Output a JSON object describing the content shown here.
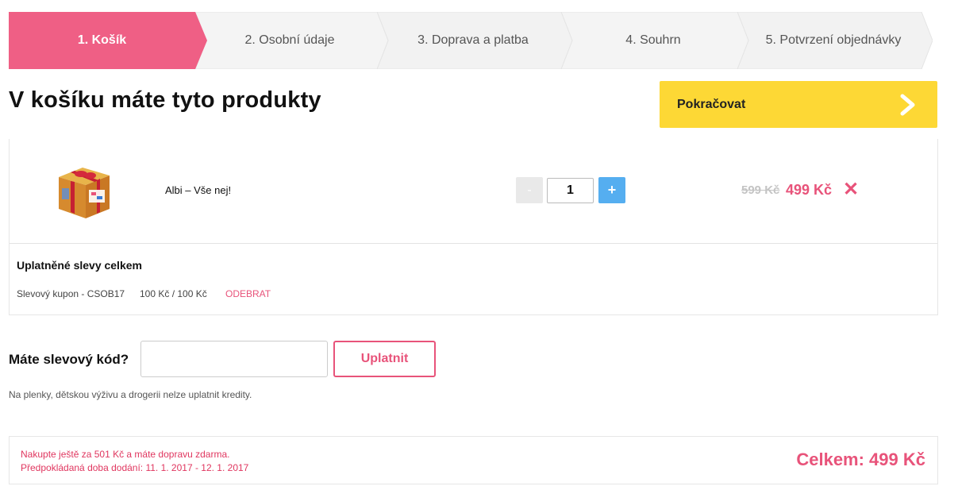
{
  "steps": [
    {
      "label": "1. Košík",
      "active": true
    },
    {
      "label": "2. Osobní údaje",
      "active": false
    },
    {
      "label": "3. Doprava a platba",
      "active": false
    },
    {
      "label": "4. Souhrn",
      "active": false
    },
    {
      "label": "5. Potvrzení objednávky",
      "active": false
    }
  ],
  "page": {
    "title": "V košíku máte tyto produkty",
    "continue_label": "Pokračovat"
  },
  "cart": {
    "product_name": "Albi – Vše nej!",
    "qty_minus": "-",
    "qty_value": "1",
    "qty_plus": "+",
    "old_price": "599 Kč",
    "new_price": "499 Kč",
    "remove_symbol": "✕"
  },
  "discounts": {
    "title": "Uplatněné slevy celkem",
    "coupon": "Slevový kupon - CSOB17",
    "amount": "100 Kč / 100 Kč",
    "remove_label": "ODEBRAT"
  },
  "code": {
    "label": "Máte slevový kód?",
    "input_value": "",
    "apply_label": "Uplatnit",
    "note": "Na plenky, dětskou výživu a drogerii nelze uplatnit kredity."
  },
  "summary": {
    "shipping_note": "Nakupte ještě za 501 Kč a máte dopravu zdarma.",
    "delivery_estimate": "Předpokládaná doba dodání: 11. 1. 2017 - 12. 1. 2017",
    "total": "Celkem: 499 Kč"
  },
  "colors": {
    "accent_pink": "#e8537a",
    "step_active": "#ef5f85",
    "continue_yellow": "#fdd835",
    "plus_blue": "#55aef0"
  }
}
